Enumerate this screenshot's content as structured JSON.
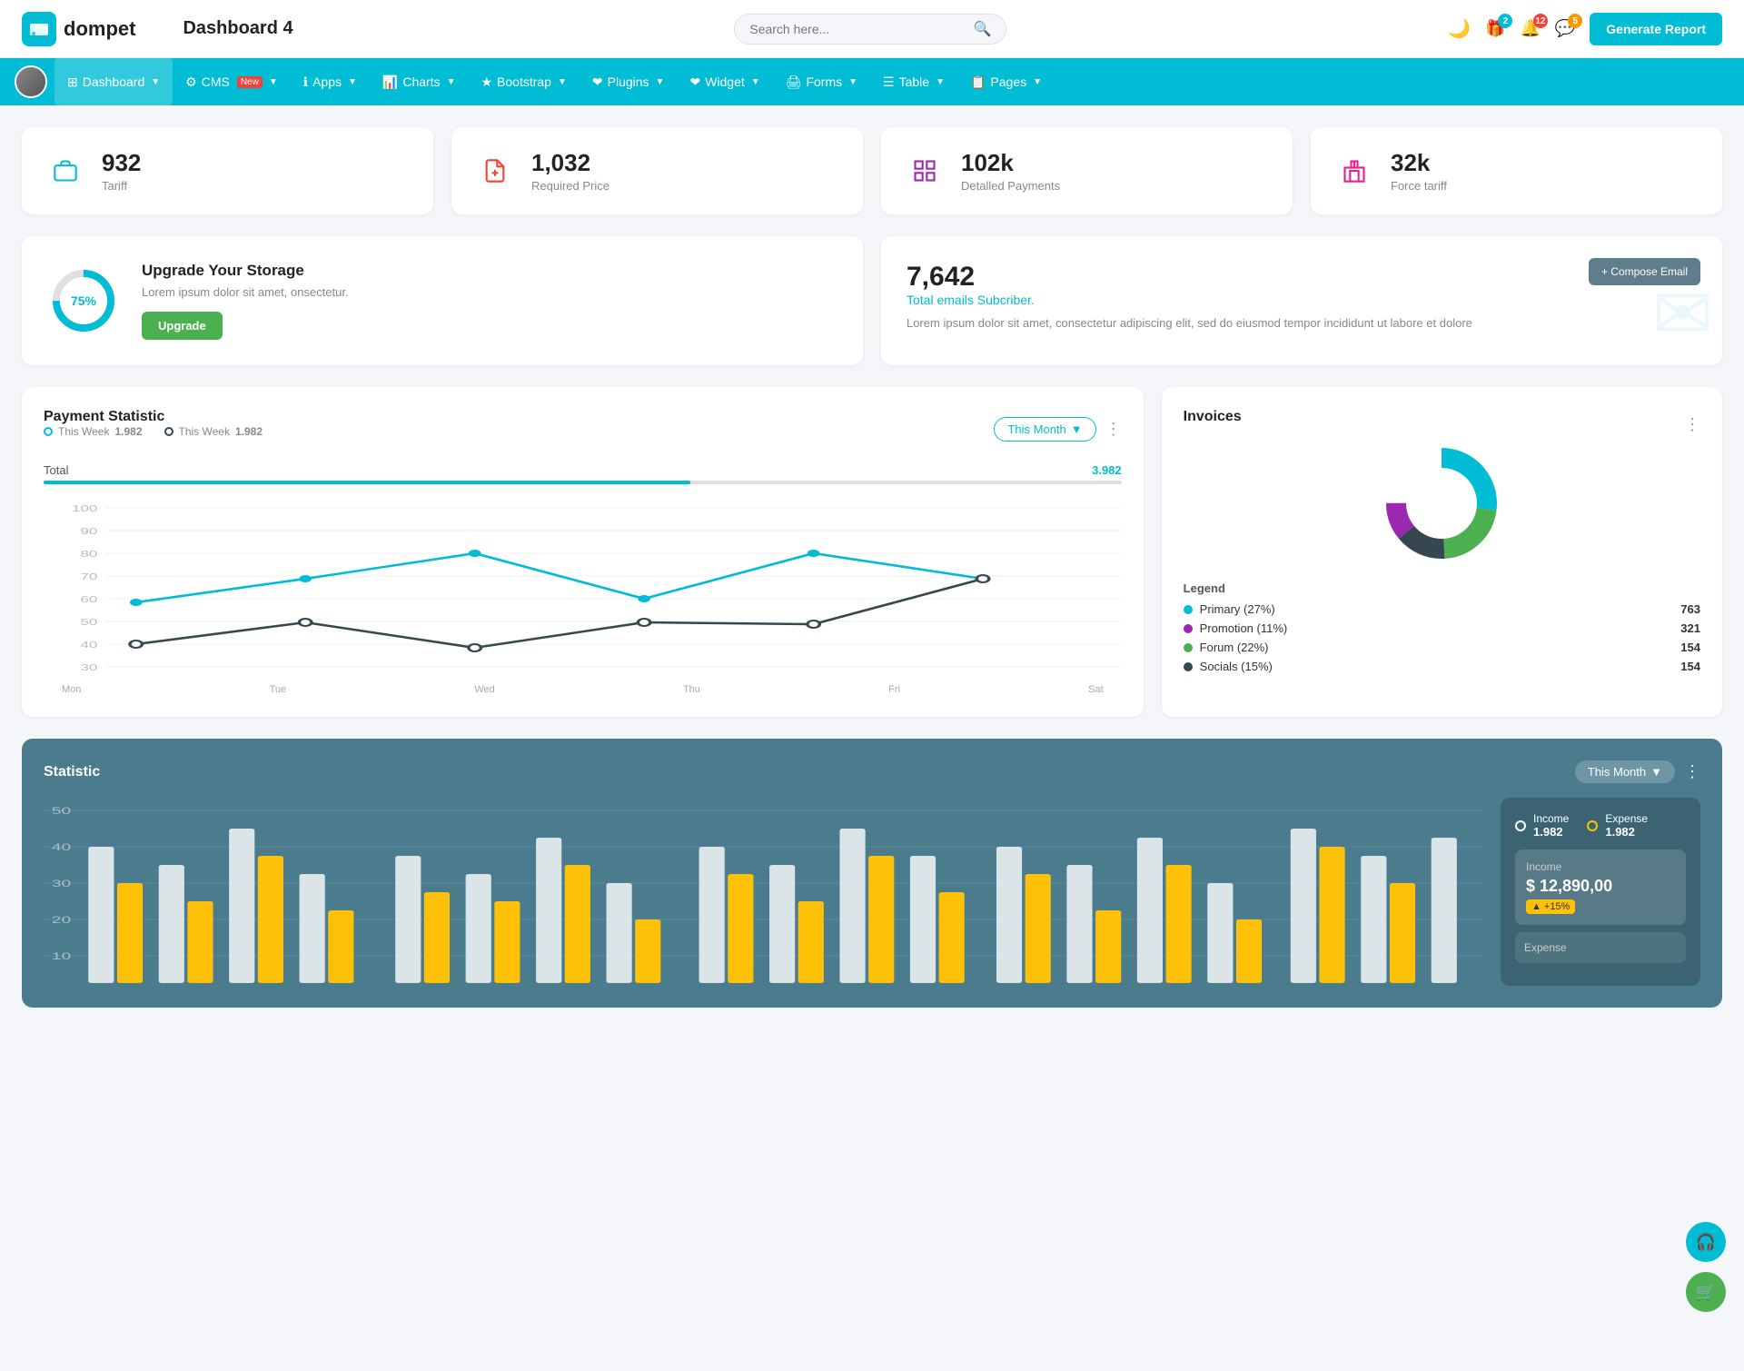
{
  "header": {
    "logo_text": "dompet",
    "page_title": "Dashboard 4",
    "search_placeholder": "Search here...",
    "actions": {
      "badge1": "2",
      "badge2": "12",
      "badge3": "5",
      "gen_report": "Generate Report"
    }
  },
  "nav": {
    "items": [
      {
        "id": "dashboard",
        "label": "Dashboard",
        "active": true,
        "has_arrow": true
      },
      {
        "id": "cms",
        "label": "CMS",
        "has_badge": true,
        "badge_text": "New",
        "has_arrow": true
      },
      {
        "id": "apps",
        "label": "Apps",
        "has_arrow": true
      },
      {
        "id": "charts",
        "label": "Charts",
        "has_arrow": true
      },
      {
        "id": "bootstrap",
        "label": "Bootstrap",
        "has_arrow": true
      },
      {
        "id": "plugins",
        "label": "Plugins",
        "has_arrow": true
      },
      {
        "id": "widget",
        "label": "Widget",
        "has_arrow": true
      },
      {
        "id": "forms",
        "label": "Forms",
        "has_arrow": true
      },
      {
        "id": "table",
        "label": "Table",
        "has_arrow": true
      },
      {
        "id": "pages",
        "label": "Pages",
        "has_arrow": true
      }
    ]
  },
  "stats": [
    {
      "id": "tariff",
      "value": "932",
      "label": "Tariff",
      "icon": "briefcase",
      "color": "teal"
    },
    {
      "id": "required_price",
      "value": "1,032",
      "label": "Required Price",
      "icon": "file-add",
      "color": "red"
    },
    {
      "id": "detailed_payments",
      "value": "102k",
      "label": "Detalled Payments",
      "icon": "chart-bar",
      "color": "purple"
    },
    {
      "id": "force_tariff",
      "value": "32k",
      "label": "Force tariff",
      "icon": "building",
      "color": "pink"
    }
  ],
  "storage": {
    "percent": "75%",
    "title": "Upgrade Your Storage",
    "description": "Lorem ipsum dolor sit amet, onsectetur.",
    "button": "Upgrade"
  },
  "email": {
    "count": "7,642",
    "subtitle": "Total emails Subcriber.",
    "description": "Lorem ipsum dolor sit amet, consectetur adipiscing elit, sed do eiusmod tempor incididunt ut labore et dolore",
    "compose_btn": "+ Compose Email"
  },
  "payment": {
    "title": "Payment Statistic",
    "legend": [
      {
        "label": "This Week",
        "value": "1.982",
        "style": "teal"
      },
      {
        "label": "This Week",
        "value": "1.982",
        "style": "dark"
      }
    ],
    "filter": "This Month",
    "total_label": "Total",
    "total_value": "3.982",
    "x_axis": [
      "Mon",
      "Tue",
      "Wed",
      "Thu",
      "Fri",
      "Sat"
    ],
    "y_axis": [
      "100",
      "90",
      "80",
      "70",
      "60",
      "50",
      "40",
      "30"
    ]
  },
  "invoices": {
    "title": "Invoices",
    "legend_title": "Legend",
    "segments": [
      {
        "label": "Primary (27%)",
        "color": "#00bcd4",
        "value": "763"
      },
      {
        "label": "Promotion (11%)",
        "color": "#9c27b0",
        "value": "321"
      },
      {
        "label": "Forum (22%)",
        "color": "#4caf50",
        "value": "154"
      },
      {
        "label": "Socials (15%)",
        "color": "#37474f",
        "value": "154"
      }
    ]
  },
  "statistic": {
    "title": "Statistic",
    "filter": "This Month",
    "income": {
      "label": "Income",
      "value": "1.982"
    },
    "expense": {
      "label": "Expense",
      "value": "1.982"
    },
    "income_box": {
      "title": "Income",
      "amount": "$ 12,890,00",
      "growth": "+15%"
    },
    "expense_box": {
      "title": "Expense"
    },
    "y_axis": [
      "50",
      "40",
      "30",
      "20",
      "10"
    ],
    "month_filter": "Month"
  },
  "float_buttons": [
    {
      "id": "headset",
      "label": "🎧"
    },
    {
      "id": "cart",
      "label": "🛒"
    }
  ]
}
